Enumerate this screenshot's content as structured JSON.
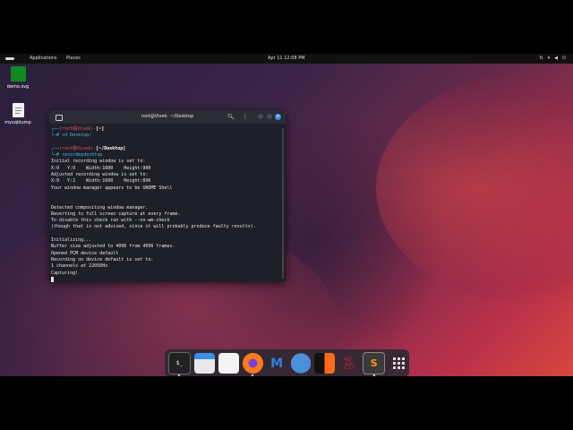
{
  "topbar": {
    "applications": "Applications",
    "places": "Places",
    "clock": "Apr 11  12:08 PM",
    "tray_icons": [
      "network-icon",
      "wifi-icon",
      "volume-icon",
      "power-icon"
    ]
  },
  "desktop_icons": [
    {
      "label": "demo.svg",
      "icon": "green-image-icon"
    },
    {
      "label": "mysqldump",
      "icon": "text-file-icon"
    }
  ],
  "terminal": {
    "title": "root@Vivek: ~/Desktop",
    "lines": [
      {
        "type": "prompt1",
        "user": "(root㉿Vivek)",
        "path": "[~]"
      },
      {
        "type": "cmd",
        "text": "cd Desktop/"
      },
      {
        "type": "blank"
      },
      {
        "type": "prompt1",
        "user": "(root㉿Vivek)",
        "path": "[~/Desktop]"
      },
      {
        "type": "cmd",
        "text": "recordmydesktop"
      },
      {
        "type": "out",
        "text": "Initial recording window is set to:"
      },
      {
        "type": "out",
        "text": "X:0   Y:0    Width:1600    Height:900"
      },
      {
        "type": "out",
        "text": "Adjusted recording window is set to:"
      },
      {
        "type": "out",
        "text": "X:0   Y:2    Width:1600    Height:896"
      },
      {
        "type": "out",
        "text": "Your window manager appears to be GNOME Shell"
      },
      {
        "type": "blank"
      },
      {
        "type": "blank"
      },
      {
        "type": "out",
        "text": "Detected compositing window manager."
      },
      {
        "type": "out",
        "text": "Reverting to full screen capture at every frame."
      },
      {
        "type": "out",
        "text": "To disable this check run with --no-wm-check"
      },
      {
        "type": "out",
        "text": "(though that is not advised, since it will probably produce faulty results)."
      },
      {
        "type": "blank"
      },
      {
        "type": "out",
        "text": "Initializing..."
      },
      {
        "type": "out",
        "text": "Buffer size adjusted to 4096 from 4096 frames."
      },
      {
        "type": "out",
        "text": "Opened PCM device default"
      },
      {
        "type": "out",
        "text": "Recording on device default is set to:"
      },
      {
        "type": "out",
        "text": "1 channels at 22050Hz"
      },
      {
        "type": "out",
        "text": "Capturing!"
      }
    ]
  },
  "dock": [
    {
      "name": "terminal-app-icon",
      "running": true
    },
    {
      "name": "files-app-icon",
      "running": false
    },
    {
      "name": "text-editor-app-icon",
      "running": false
    },
    {
      "name": "firefox-app-icon",
      "running": true
    },
    {
      "name": "metasploit-app-icon",
      "running": false
    },
    {
      "name": "wireshark-app-icon",
      "running": false
    },
    {
      "name": "burpsuite-app-icon",
      "running": false
    },
    {
      "name": "cherrytree-app-icon",
      "running": false
    },
    {
      "name": "sublime-text-app-icon",
      "running": true
    },
    {
      "name": "show-apps-grid-icon",
      "running": false
    }
  ],
  "colors": {
    "prompt_frame": "#4aa3f2",
    "prompt_user": "#e05561",
    "command": "#3fb8e8",
    "terminal_bg": "#1e1f29"
  }
}
